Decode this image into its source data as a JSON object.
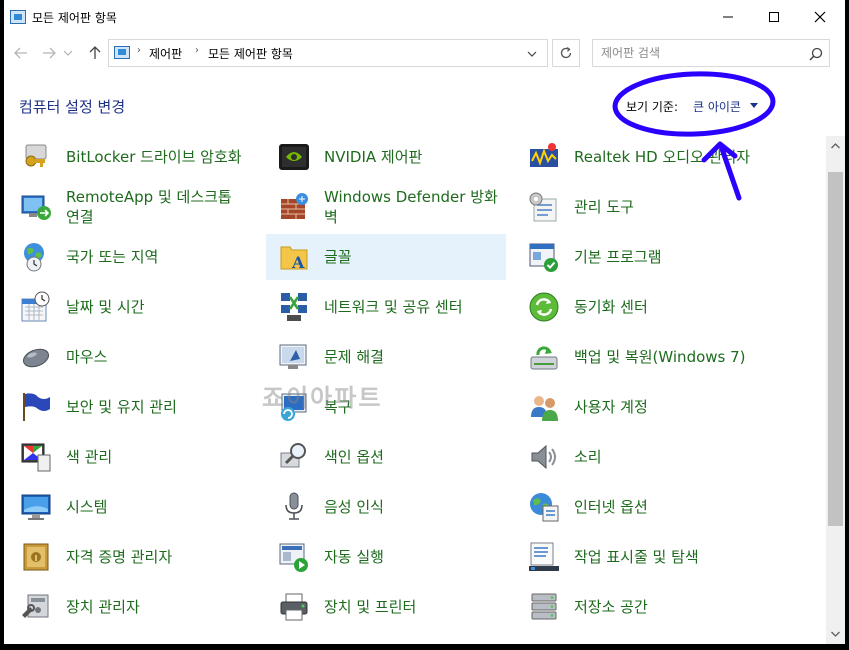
{
  "window": {
    "title": "모든 제어판 항목"
  },
  "address": {
    "crumbs": [
      "제어판",
      "모든 제어판 항목"
    ]
  },
  "search": {
    "placeholder": "제어판 검색"
  },
  "header": {
    "title": "컴퓨터 설정 변경",
    "view_by_label": "보기 기준:",
    "view_by_value": "큰 아이콘"
  },
  "watermark": "죠이아파트",
  "colors": {
    "link": "#1e6b1e",
    "accent": "#1e3287",
    "highlight": "#e5f1fb",
    "annotation": "#2b00ff"
  },
  "items": [
    {
      "label": "BitLocker 드라이브 암호화",
      "icon": "bitlocker-keys-icon",
      "highlighted": false
    },
    {
      "label": "NVIDIA 제어판",
      "icon": "nvidia-icon",
      "highlighted": false
    },
    {
      "label": "Realtek HD 오디오 관리자",
      "icon": "realtek-audio-icon",
      "highlighted": false
    },
    {
      "label": "RemoteApp 및 데스크톱 연결",
      "icon": "remoteapp-icon",
      "highlighted": false
    },
    {
      "label": "Windows Defender 방화벽",
      "icon": "firewall-icon",
      "highlighted": false
    },
    {
      "label": "관리 도구",
      "icon": "admin-tools-icon",
      "highlighted": false
    },
    {
      "label": "국가 또는 지역",
      "icon": "region-globe-icon",
      "highlighted": false
    },
    {
      "label": "글꼴",
      "icon": "fonts-folder-icon",
      "highlighted": true
    },
    {
      "label": "기본 프로그램",
      "icon": "default-programs-icon",
      "highlighted": false
    },
    {
      "label": "날짜 및 시간",
      "icon": "calendar-clock-icon",
      "highlighted": false
    },
    {
      "label": "네트워크 및 공유 센터",
      "icon": "network-icon",
      "highlighted": false
    },
    {
      "label": "동기화 센터",
      "icon": "sync-icon",
      "highlighted": false
    },
    {
      "label": "마우스",
      "icon": "mouse-icon",
      "highlighted": false
    },
    {
      "label": "문제 해결",
      "icon": "troubleshoot-icon",
      "highlighted": false
    },
    {
      "label": "백업 및 복원(Windows 7)",
      "icon": "backup-icon",
      "highlighted": false
    },
    {
      "label": "보안 및 유지 관리",
      "icon": "security-flag-icon",
      "highlighted": false
    },
    {
      "label": "복구",
      "icon": "recovery-icon",
      "highlighted": false
    },
    {
      "label": "사용자 계정",
      "icon": "user-accounts-icon",
      "highlighted": false
    },
    {
      "label": "색 관리",
      "icon": "color-management-icon",
      "highlighted": false
    },
    {
      "label": "색인 옵션",
      "icon": "indexing-icon",
      "highlighted": false
    },
    {
      "label": "소리",
      "icon": "speaker-icon",
      "highlighted": false
    },
    {
      "label": "시스템",
      "icon": "system-monitor-icon",
      "highlighted": false
    },
    {
      "label": "음성 인식",
      "icon": "microphone-icon",
      "highlighted": false
    },
    {
      "label": "인터넷 옵션",
      "icon": "internet-options-icon",
      "highlighted": false
    },
    {
      "label": "자격 증명 관리자",
      "icon": "credential-vault-icon",
      "highlighted": false
    },
    {
      "label": "자동 실행",
      "icon": "autoplay-icon",
      "highlighted": false
    },
    {
      "label": "작업 표시줄 및 탐색",
      "icon": "taskbar-icon",
      "highlighted": false
    },
    {
      "label": "장치 관리자",
      "icon": "device-manager-icon",
      "highlighted": false
    },
    {
      "label": "장치 및 프린터",
      "icon": "printer-icon",
      "highlighted": false
    },
    {
      "label": "저장소 공간",
      "icon": "storage-spaces-icon",
      "highlighted": false
    }
  ]
}
